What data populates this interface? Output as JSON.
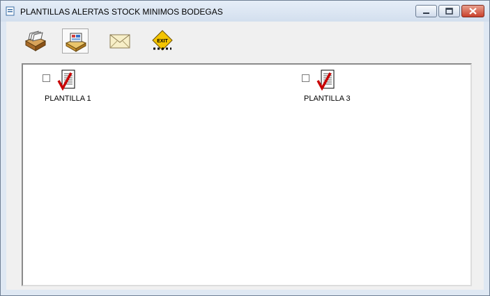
{
  "window": {
    "title": "PLANTILLAS ALERTAS STOCK MINIMOS BODEGAS"
  },
  "toolbar": {
    "buttons": [
      {
        "name": "archive",
        "icon": "card-file-icon"
      },
      {
        "name": "database",
        "icon": "database-tray-icon",
        "active": true
      },
      {
        "name": "email",
        "icon": "envelope-icon"
      },
      {
        "name": "exit",
        "icon": "exit-sign-icon",
        "sign_text": "EXIT"
      }
    ]
  },
  "templates": [
    {
      "label": "PLANTILLA 1",
      "checked": false,
      "icon": "document-check-icon"
    },
    {
      "label": "PLANTILLA 3",
      "checked": false,
      "icon": "document-check-icon"
    }
  ]
}
